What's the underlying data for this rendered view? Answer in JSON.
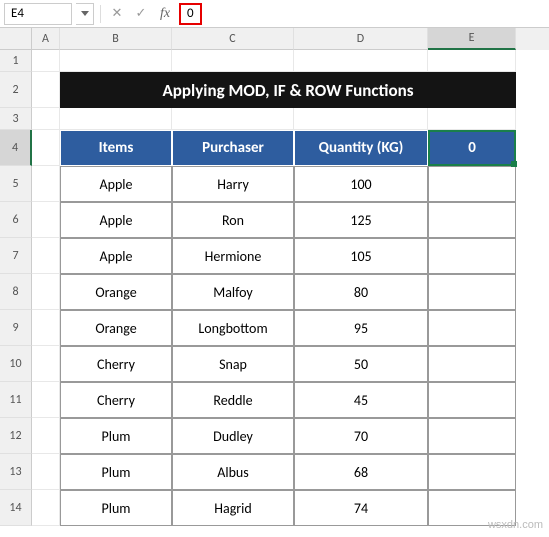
{
  "namebox": {
    "value": "E4"
  },
  "formula": {
    "value": "0"
  },
  "columns": [
    "A",
    "B",
    "C",
    "D",
    "E"
  ],
  "rows": [
    "1",
    "2",
    "3",
    "4",
    "5",
    "6",
    "7",
    "8",
    "9",
    "10",
    "11",
    "12",
    "13",
    "14"
  ],
  "title": "Applying MOD, IF & ROW Functions",
  "headers": {
    "b": "Items",
    "c": "Purchaser",
    "d": "Quantity (KG)",
    "e": "0"
  },
  "chart_data": {
    "type": "table",
    "columns": [
      "Items",
      "Purchaser",
      "Quantity (KG)"
    ],
    "rows": [
      {
        "items": "Apple",
        "purchaser": "Harry",
        "qty": "100"
      },
      {
        "items": "Apple",
        "purchaser": "Ron",
        "qty": "125"
      },
      {
        "items": "Apple",
        "purchaser": "Hermione",
        "qty": "105"
      },
      {
        "items": "Orange",
        "purchaser": "Malfoy",
        "qty": "80"
      },
      {
        "items": "Orange",
        "purchaser": "Longbottom",
        "qty": "95"
      },
      {
        "items": "Cherry",
        "purchaser": "Snap",
        "qty": "50"
      },
      {
        "items": "Cherry",
        "purchaser": "Reddle",
        "qty": "45"
      },
      {
        "items": "Plum",
        "purchaser": "Dudley",
        "qty": "70"
      },
      {
        "items": "Plum",
        "purchaser": "Albus",
        "qty": "68"
      },
      {
        "items": "Plum",
        "purchaser": "Hagrid",
        "qty": "74"
      }
    ]
  },
  "watermark": "wsxdn.com"
}
